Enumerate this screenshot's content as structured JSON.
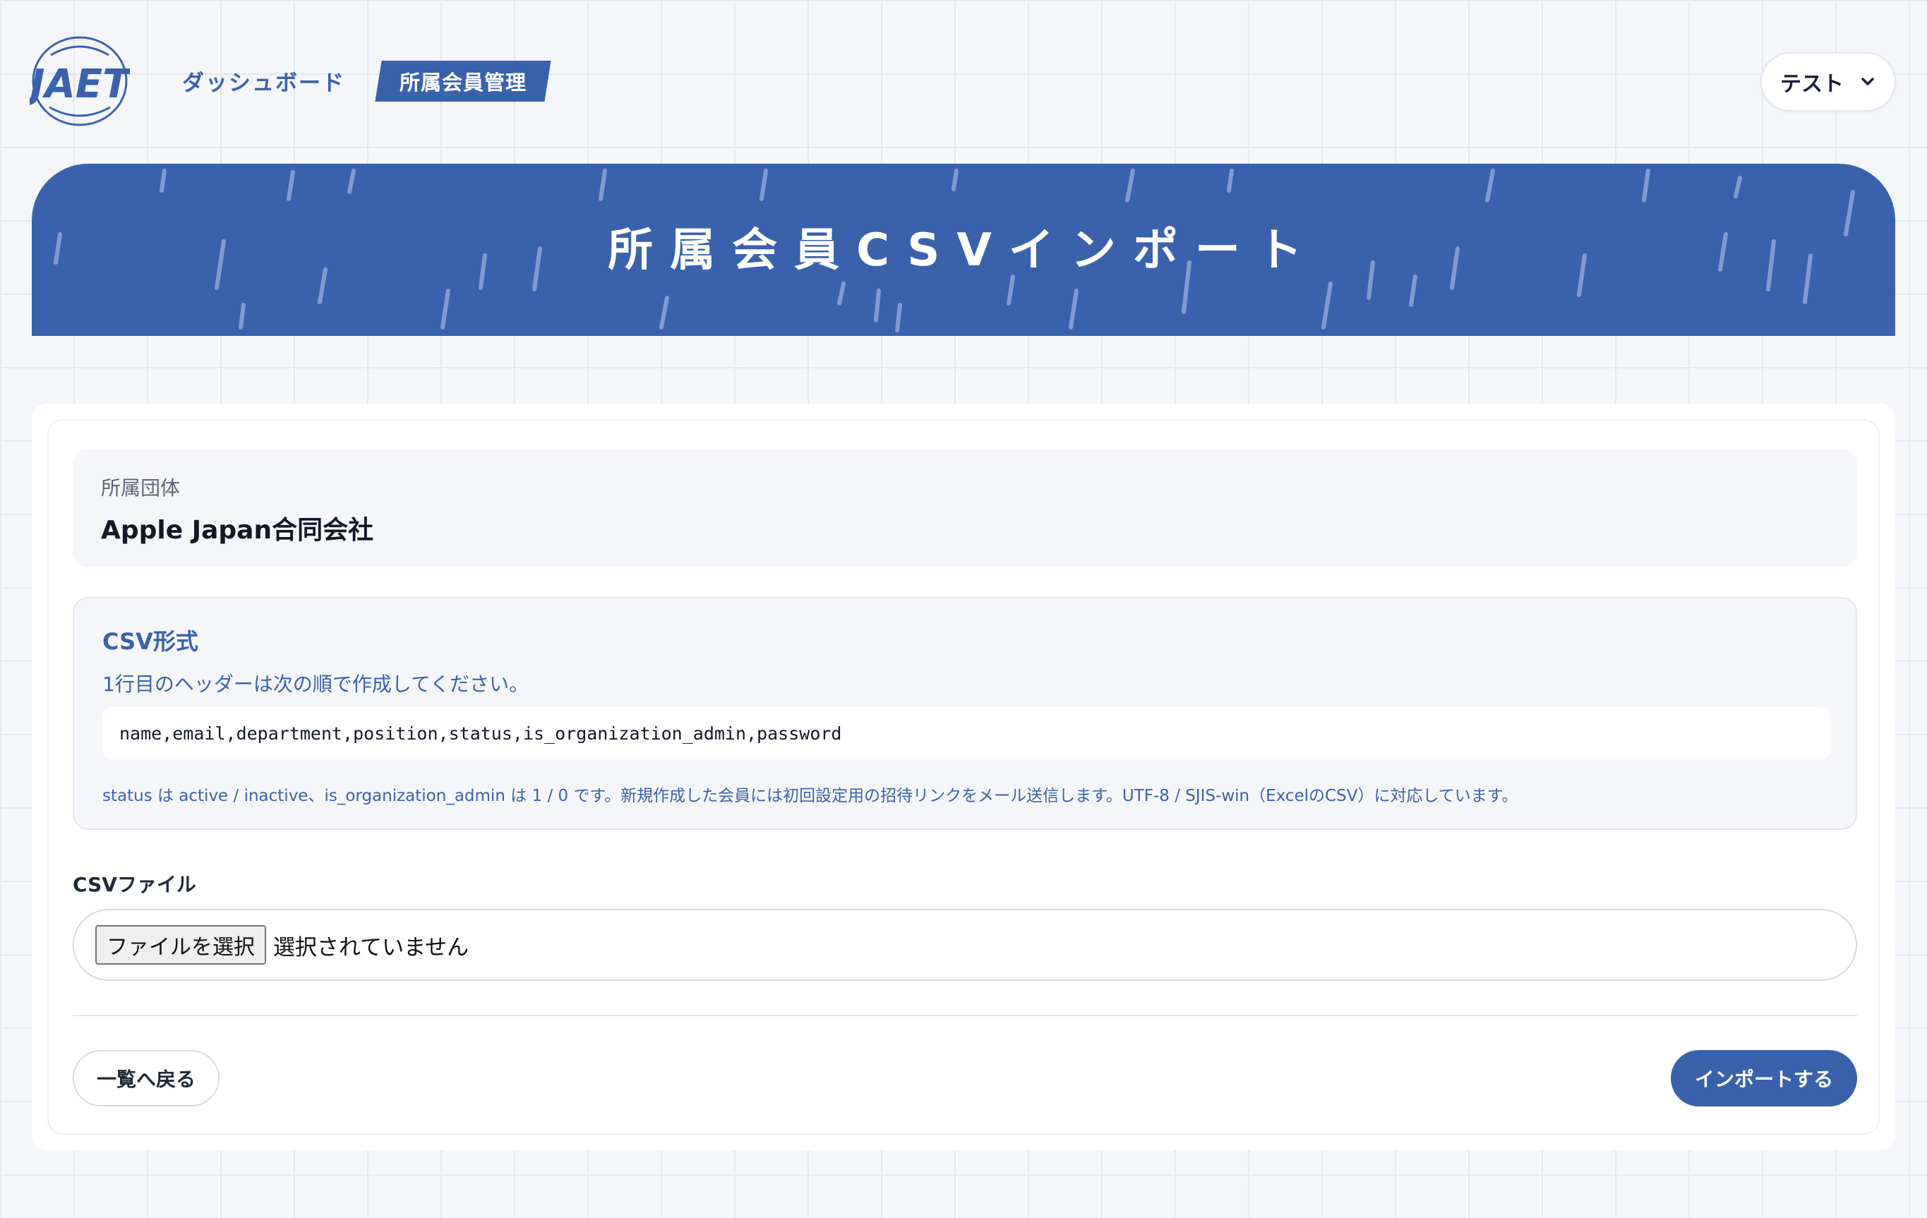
{
  "header": {
    "logo_text": "JAET",
    "nav": {
      "dashboard_label": "ダッシュボード",
      "members_label": "所属会員管理"
    },
    "user_menu": {
      "name": "テスト",
      "icon": "chevron-down-icon"
    }
  },
  "hero": {
    "title": "所属会員CSVインポート"
  },
  "organization": {
    "label": "所属団体",
    "name": "Apple Japan合同会社"
  },
  "csv_format": {
    "title": "CSV形式",
    "description": "1行目のヘッダーは次の順で作成してください。",
    "header_columns": "name,email,department,position,status,is_organization_admin,password",
    "note": "status は active / inactive、is_organization_admin は 1 / 0 です。新規作成した会員には初回設定用の招待リンクをメール送信します。UTF-8 / SJIS-win（ExcelのCSV）に対応しています。"
  },
  "file_input": {
    "label": "CSVファイル",
    "button_label": "ファイルを選択",
    "status": "選択されていません"
  },
  "actions": {
    "back_label": "一覧へ戻る",
    "import_label": "インポートする"
  },
  "colors": {
    "primary": "#3a62ac",
    "background": "#f4f6fa",
    "panel": "#f5f6fa"
  }
}
